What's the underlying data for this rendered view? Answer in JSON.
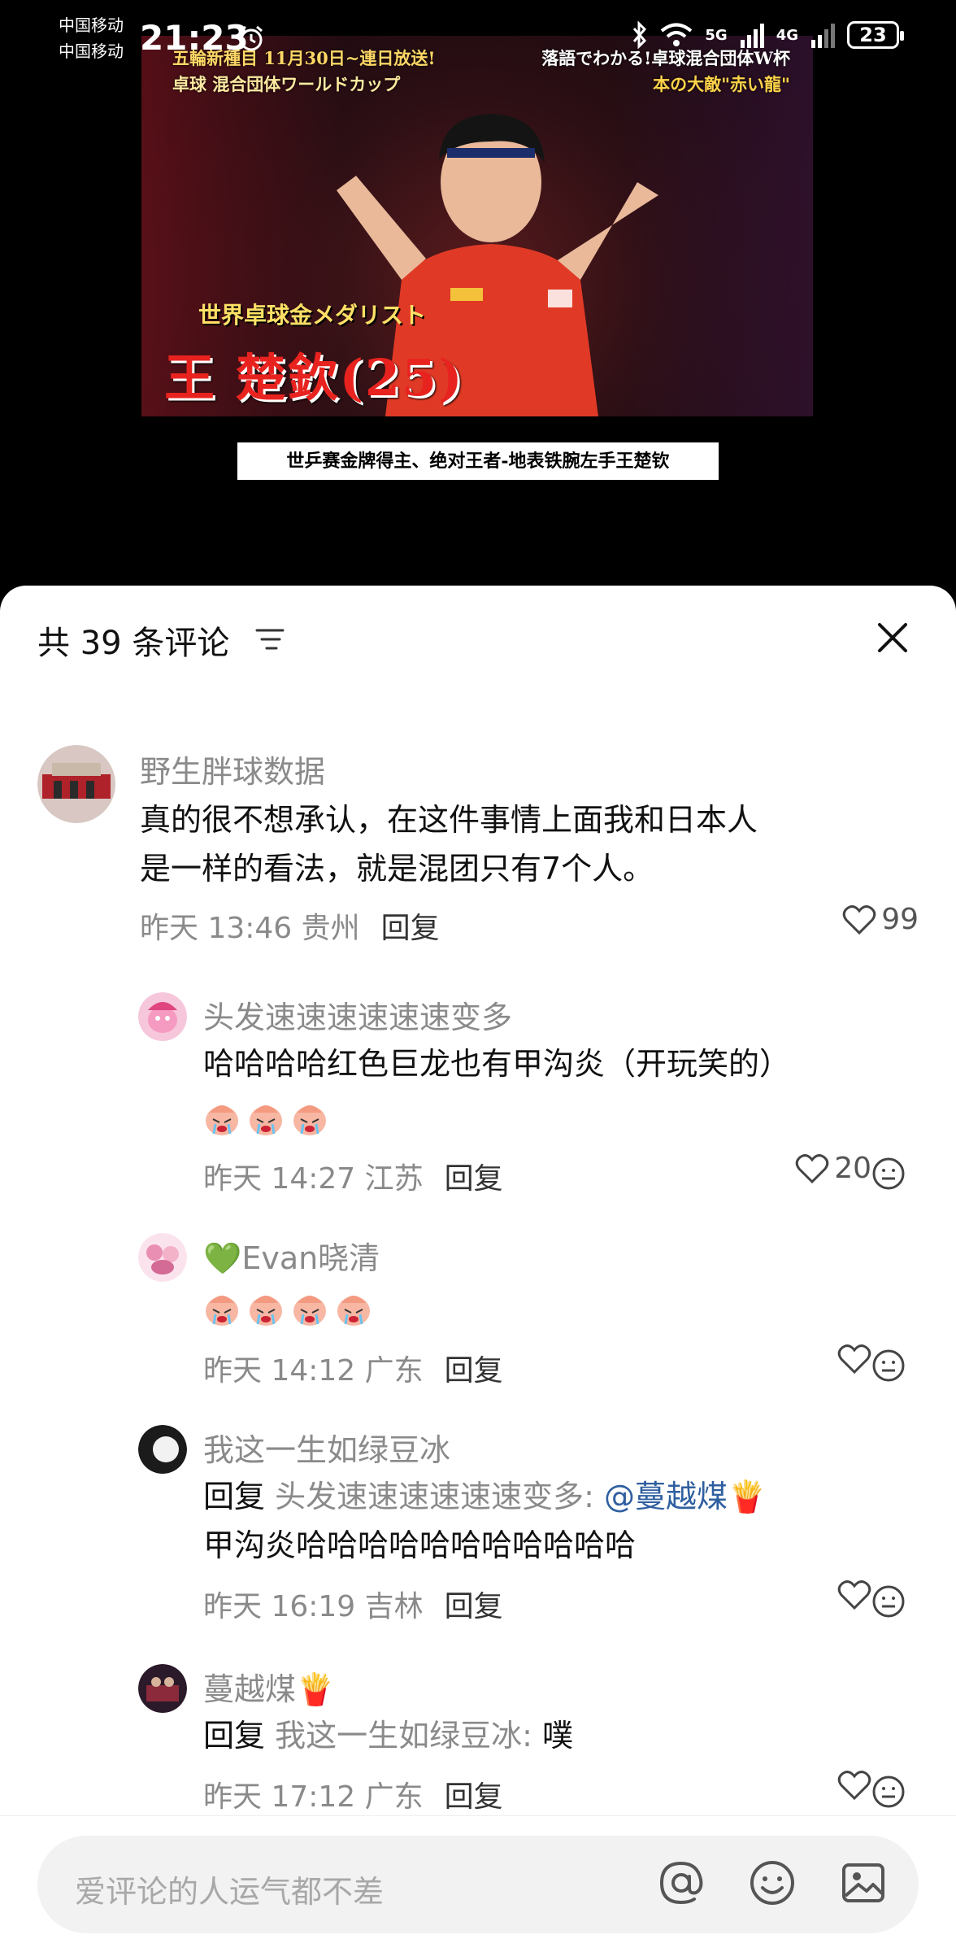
{
  "status_bar": {
    "carrier_1": "中国移动",
    "carrier_2": "中国移动",
    "time": "21:23",
    "net_5g": "5G",
    "net_4g": "4G",
    "battery": "23"
  },
  "video": {
    "overlay_top_left_1": "五輪新種目 11月30日~連日放送!",
    "overlay_top_left_2": "卓球 混合団体ワールドカップ",
    "overlay_top_right_1": "落語でわかる!卓球混合団体W杯",
    "overlay_top_right_2": "本の大敵\"赤い龍\"",
    "overlay_medal": "世界卓球金メダリスト",
    "overlay_name": "王 楚欽(25)",
    "caption": "世乒赛金牌得主、绝对王者-地表铁腕左手王楚钦"
  },
  "comments_panel": {
    "title": "共 39 条评论",
    "comments": [
      {
        "author": "野生胖球数据",
        "text_line_1": "真的很不想承认，在这件事情上面我和日本人",
        "text_line_2": "是一样的看法，就是混团只有7个人。",
        "meta": "昨天 13:46 贵州",
        "reply_label": "回复",
        "likes": "99"
      },
      {
        "author": "头发速速速速速速变多",
        "text_line_1": "哈哈哈哈红色巨龙也有甲沟炎（开玩笑的）",
        "meta": "昨天 14:27 江苏",
        "reply_label": "回复",
        "likes": "20"
      },
      {
        "author": "💚Evan晓清",
        "meta": "昨天 14:12 广东",
        "reply_label": "回复"
      },
      {
        "author": "我这一生如绿豆冰",
        "reply_prefix": "回复",
        "reply_target": "头发速速速速速速变多:",
        "mention": "@蔓越煤🍟",
        "text_line_2": "甲沟炎哈哈哈哈哈哈哈哈哈哈哈",
        "meta": "昨天 16:19 吉林",
        "reply_label": "回复"
      },
      {
        "author": "蔓越煤🍟",
        "reply_prefix": "回复",
        "reply_target": "我这一生如绿豆冰:",
        "text": "噗",
        "meta": "昨天 17:12 广东",
        "reply_label": "回复"
      }
    ]
  },
  "input": {
    "placeholder": "爱评论的人运气都不差"
  },
  "colors": {
    "secondary_text": "#8a8a8a",
    "mention": "#2f5fa0",
    "input_bg": "#f2f2f2"
  },
  "icons": [
    "alarm-icon",
    "bluetooth-icon",
    "wifi-icon",
    "signal-icon",
    "filter-icon",
    "close-icon",
    "heart-icon",
    "emoji-react-icon",
    "at-icon",
    "emoji-icon",
    "image-icon",
    "crying-sticker"
  ]
}
